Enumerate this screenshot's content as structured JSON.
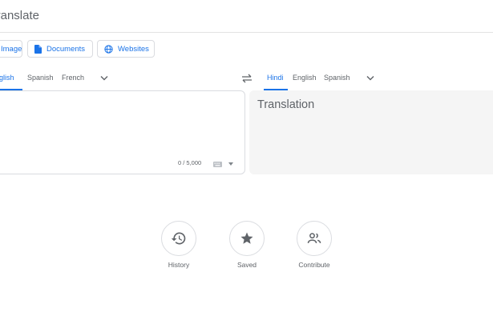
{
  "header": {
    "title": "Translate"
  },
  "modes": [
    {
      "label": "Images"
    },
    {
      "label": "Documents"
    },
    {
      "label": "Websites"
    }
  ],
  "source_langs": [
    {
      "label": "English",
      "active": true
    },
    {
      "label": "Spanish",
      "active": false
    },
    {
      "label": "French",
      "active": false
    }
  ],
  "target_langs": [
    {
      "label": "Hindi",
      "active": true
    },
    {
      "label": "English",
      "active": false
    },
    {
      "label": "Spanish",
      "active": false
    }
  ],
  "source": {
    "char_count": "0 / 5,000"
  },
  "target": {
    "placeholder": "Translation"
  },
  "actions": [
    {
      "label": "History",
      "icon": "history-icon"
    },
    {
      "label": "Saved",
      "icon": "star-icon"
    },
    {
      "label": "Contribute",
      "icon": "people-icon"
    }
  ],
  "colors": {
    "accent": "#1a73e8",
    "panel_bg": "#f5f5f5",
    "border": "#dadce0"
  }
}
